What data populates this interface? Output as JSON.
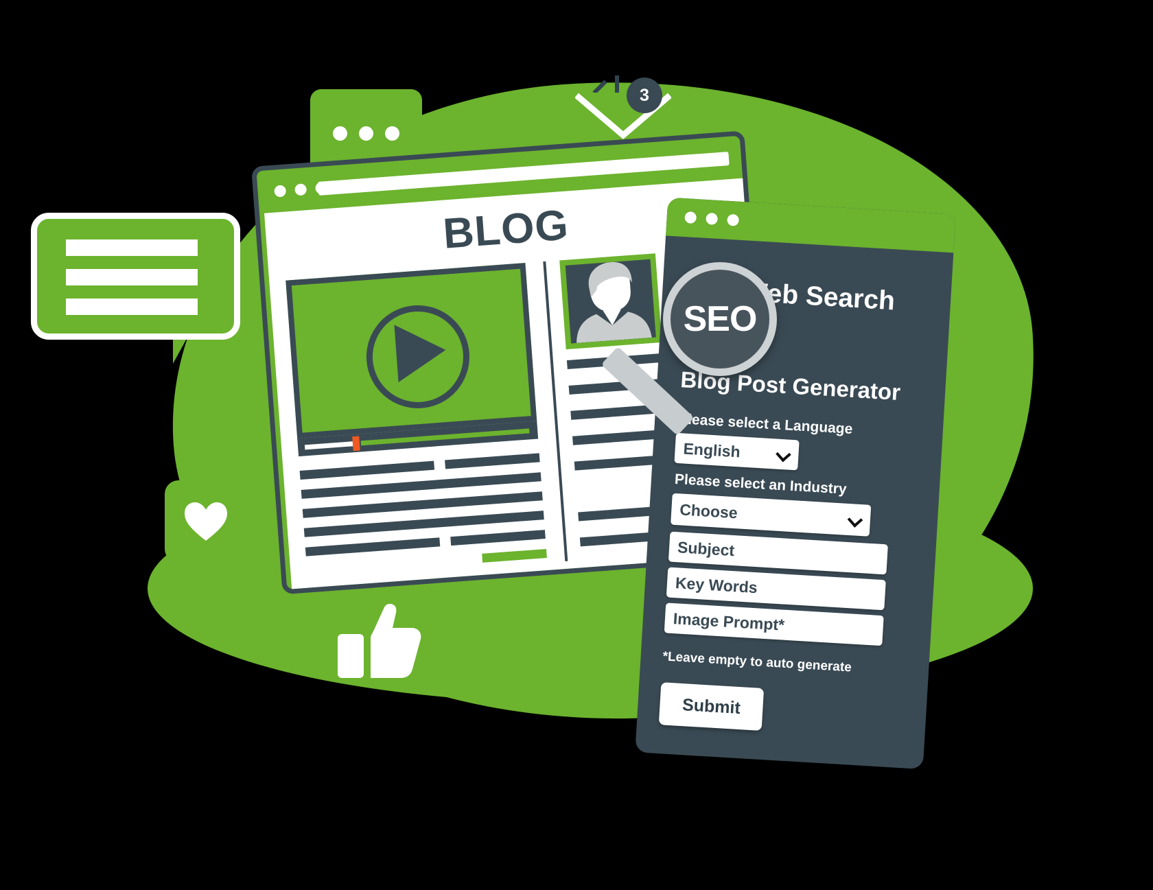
{
  "scene": {
    "colors": {
      "green": "#6cb32e",
      "dark": "#3a4a54",
      "white": "#ffffff",
      "orange": "#f05a22",
      "metal": "#cdd2d4"
    }
  },
  "notifications": {
    "envelope_badge_count": "3"
  },
  "blog_window": {
    "title": "BLOG",
    "window_dots": [
      "dot",
      "dot",
      "dot"
    ],
    "video": {
      "play_icon": "play-icon",
      "progress_percent": 22
    }
  },
  "seo_panel": {
    "magnifier_label": "SEO",
    "header_title": "Web Search",
    "header_full": "SEO Web Search",
    "form_title": "Blog Post Generator",
    "fields": [
      {
        "label": "Please select a Language",
        "type": "select",
        "value": "English"
      },
      {
        "label": "Please select an Industry",
        "type": "select",
        "value": "Choose"
      },
      {
        "label": "",
        "type": "text",
        "value": "Subject"
      },
      {
        "label": "",
        "type": "text",
        "value": "Key Words"
      },
      {
        "label": "",
        "type": "text",
        "value": "Image Prompt*"
      }
    ],
    "hint": "*Leave empty to auto generate",
    "submit_label": "Submit"
  }
}
